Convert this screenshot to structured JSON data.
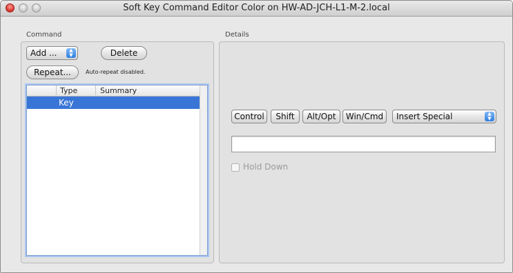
{
  "window": {
    "title": "Soft Key Command Editor Color on  HW-AD-JCH-L1-M-2.local"
  },
  "command": {
    "section_label": "Command",
    "add_label": "Add ...",
    "delete_label": "Delete",
    "repeat_label": "Repeat...",
    "repeat_status": "Auto-repeat disabled.",
    "table": {
      "columns": [
        "Type",
        "Summary"
      ],
      "rows": [
        {
          "type": "Key",
          "summary": "",
          "selected": true
        }
      ]
    }
  },
  "details": {
    "section_label": "Details",
    "modifier_buttons": {
      "control": "Control",
      "shift": "Shift",
      "alt_opt": "Alt/Opt",
      "win_cmd": "Win/Cmd"
    },
    "insert_special": "Insert Special",
    "text_value": "",
    "hold_down_label": "Hold Down",
    "hold_down_checked": false
  },
  "colors": {
    "selection": "#3875d7",
    "close_button": "#d2302a"
  }
}
